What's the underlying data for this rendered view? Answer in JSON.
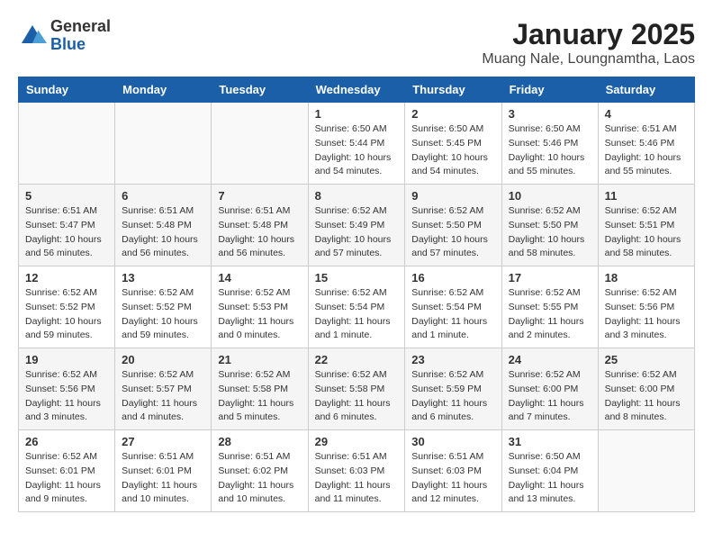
{
  "header": {
    "logo_general": "General",
    "logo_blue": "Blue",
    "month_title": "January 2025",
    "location": "Muang Nale, Loungnamtha, Laos"
  },
  "weekdays": [
    "Sunday",
    "Monday",
    "Tuesday",
    "Wednesday",
    "Thursday",
    "Friday",
    "Saturday"
  ],
  "weeks": [
    [
      {
        "day": "",
        "info": ""
      },
      {
        "day": "",
        "info": ""
      },
      {
        "day": "",
        "info": ""
      },
      {
        "day": "1",
        "info": "Sunrise: 6:50 AM\nSunset: 5:44 PM\nDaylight: 10 hours\nand 54 minutes."
      },
      {
        "day": "2",
        "info": "Sunrise: 6:50 AM\nSunset: 5:45 PM\nDaylight: 10 hours\nand 54 minutes."
      },
      {
        "day": "3",
        "info": "Sunrise: 6:50 AM\nSunset: 5:46 PM\nDaylight: 10 hours\nand 55 minutes."
      },
      {
        "day": "4",
        "info": "Sunrise: 6:51 AM\nSunset: 5:46 PM\nDaylight: 10 hours\nand 55 minutes."
      }
    ],
    [
      {
        "day": "5",
        "info": "Sunrise: 6:51 AM\nSunset: 5:47 PM\nDaylight: 10 hours\nand 56 minutes."
      },
      {
        "day": "6",
        "info": "Sunrise: 6:51 AM\nSunset: 5:48 PM\nDaylight: 10 hours\nand 56 minutes."
      },
      {
        "day": "7",
        "info": "Sunrise: 6:51 AM\nSunset: 5:48 PM\nDaylight: 10 hours\nand 56 minutes."
      },
      {
        "day": "8",
        "info": "Sunrise: 6:52 AM\nSunset: 5:49 PM\nDaylight: 10 hours\nand 57 minutes."
      },
      {
        "day": "9",
        "info": "Sunrise: 6:52 AM\nSunset: 5:50 PM\nDaylight: 10 hours\nand 57 minutes."
      },
      {
        "day": "10",
        "info": "Sunrise: 6:52 AM\nSunset: 5:50 PM\nDaylight: 10 hours\nand 58 minutes."
      },
      {
        "day": "11",
        "info": "Sunrise: 6:52 AM\nSunset: 5:51 PM\nDaylight: 10 hours\nand 58 minutes."
      }
    ],
    [
      {
        "day": "12",
        "info": "Sunrise: 6:52 AM\nSunset: 5:52 PM\nDaylight: 10 hours\nand 59 minutes."
      },
      {
        "day": "13",
        "info": "Sunrise: 6:52 AM\nSunset: 5:52 PM\nDaylight: 10 hours\nand 59 minutes."
      },
      {
        "day": "14",
        "info": "Sunrise: 6:52 AM\nSunset: 5:53 PM\nDaylight: 11 hours\nand 0 minutes."
      },
      {
        "day": "15",
        "info": "Sunrise: 6:52 AM\nSunset: 5:54 PM\nDaylight: 11 hours\nand 1 minute."
      },
      {
        "day": "16",
        "info": "Sunrise: 6:52 AM\nSunset: 5:54 PM\nDaylight: 11 hours\nand 1 minute."
      },
      {
        "day": "17",
        "info": "Sunrise: 6:52 AM\nSunset: 5:55 PM\nDaylight: 11 hours\nand 2 minutes."
      },
      {
        "day": "18",
        "info": "Sunrise: 6:52 AM\nSunset: 5:56 PM\nDaylight: 11 hours\nand 3 minutes."
      }
    ],
    [
      {
        "day": "19",
        "info": "Sunrise: 6:52 AM\nSunset: 5:56 PM\nDaylight: 11 hours\nand 3 minutes."
      },
      {
        "day": "20",
        "info": "Sunrise: 6:52 AM\nSunset: 5:57 PM\nDaylight: 11 hours\nand 4 minutes."
      },
      {
        "day": "21",
        "info": "Sunrise: 6:52 AM\nSunset: 5:58 PM\nDaylight: 11 hours\nand 5 minutes."
      },
      {
        "day": "22",
        "info": "Sunrise: 6:52 AM\nSunset: 5:58 PM\nDaylight: 11 hours\nand 6 minutes."
      },
      {
        "day": "23",
        "info": "Sunrise: 6:52 AM\nSunset: 5:59 PM\nDaylight: 11 hours\nand 6 minutes."
      },
      {
        "day": "24",
        "info": "Sunrise: 6:52 AM\nSunset: 6:00 PM\nDaylight: 11 hours\nand 7 minutes."
      },
      {
        "day": "25",
        "info": "Sunrise: 6:52 AM\nSunset: 6:00 PM\nDaylight: 11 hours\nand 8 minutes."
      }
    ],
    [
      {
        "day": "26",
        "info": "Sunrise: 6:52 AM\nSunset: 6:01 PM\nDaylight: 11 hours\nand 9 minutes."
      },
      {
        "day": "27",
        "info": "Sunrise: 6:51 AM\nSunset: 6:01 PM\nDaylight: 11 hours\nand 10 minutes."
      },
      {
        "day": "28",
        "info": "Sunrise: 6:51 AM\nSunset: 6:02 PM\nDaylight: 11 hours\nand 10 minutes."
      },
      {
        "day": "29",
        "info": "Sunrise: 6:51 AM\nSunset: 6:03 PM\nDaylight: 11 hours\nand 11 minutes."
      },
      {
        "day": "30",
        "info": "Sunrise: 6:51 AM\nSunset: 6:03 PM\nDaylight: 11 hours\nand 12 minutes."
      },
      {
        "day": "31",
        "info": "Sunrise: 6:50 AM\nSunset: 6:04 PM\nDaylight: 11 hours\nand 13 minutes."
      },
      {
        "day": "",
        "info": ""
      }
    ]
  ]
}
